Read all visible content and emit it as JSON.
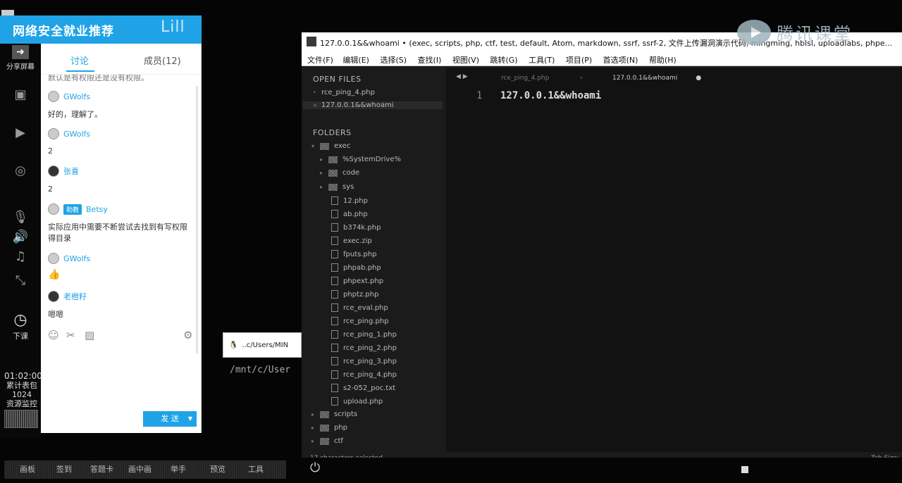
{
  "banner": {
    "title": "网络安全就业推荐",
    "deco": "Lill"
  },
  "left_bar": {
    "share_label": "分享屏幕",
    "end_label": "下课",
    "timer": "01:02:00",
    "stats_line1": "累计表包",
    "stats_line2": "1024",
    "stats_line3": "资源监控"
  },
  "chat": {
    "tab_discuss": "讨论",
    "tab_members": "成员(12)",
    "top_fragment": "默认是有权限还是没有权限。",
    "messages": [
      {
        "user": "GWolfs",
        "text": "好的，理解了。"
      },
      {
        "user": "GWolfs",
        "text": "2"
      },
      {
        "user": "张喜",
        "text": "2"
      },
      {
        "user": "Betsy",
        "badge": "助教",
        "text1": "实际应用中需要不断尝试去找到有写权限",
        "text2": "得目录"
      },
      {
        "user": "GWolfs",
        "text": "👍"
      },
      {
        "user": "老橙籽",
        "text": "嗯嗯"
      }
    ],
    "send_label": "发 送"
  },
  "terminal": {
    "tab_label": "..c/Users/MIN",
    "path_line": "/mnt/c/User"
  },
  "editor": {
    "title": "127.0.0.1&&whoami • (exec, scripts, php, ctf, test, default, Atom, markdown, ssrf, ssrf-2, 文件上传漏洞演示代码, mingming, hblsl, uploadlabs, phpe...",
    "menu": [
      "文件(F)",
      "编辑(E)",
      "选择(S)",
      "查找(I)",
      "视图(V)",
      "跳转(G)",
      "工具(T)",
      "项目(P)",
      "首选项(N)",
      "帮助(H)"
    ],
    "open_files_label": "OPEN FILES",
    "open_files": [
      "rce_ping_4.php",
      "127.0.0.1&&whoami"
    ],
    "folders_label": "FOLDERS",
    "tree": [
      "exec",
      "%SystemDrive%",
      "code",
      "sys",
      "12.php",
      "ab.php",
      "b374k.php",
      "exec.zip",
      "fputs.php",
      "phpab.php",
      "phpext.php",
      "phptz.php",
      "rce_eval.php",
      "rce_ping.php",
      "rce_ping_1.php",
      "rce_ping_2.php",
      "rce_ping_3.php",
      "rce_ping_4.php",
      "s2-052_poc.txt",
      "upload.php",
      "scripts",
      "php",
      "ctf"
    ],
    "tabs": [
      "rce_ping_4.php",
      "127.0.0.1&&whoami"
    ],
    "line_number": "1",
    "code": "127.0.0.1&&whoami",
    "status_left": "17 characters selected",
    "status_right": "Tab Size:"
  },
  "watermark": {
    "text": "腾讯课堂"
  },
  "bottom_bar": [
    "画板",
    "签到",
    "答题卡",
    "画中画",
    "举手",
    "预览",
    "工具"
  ]
}
